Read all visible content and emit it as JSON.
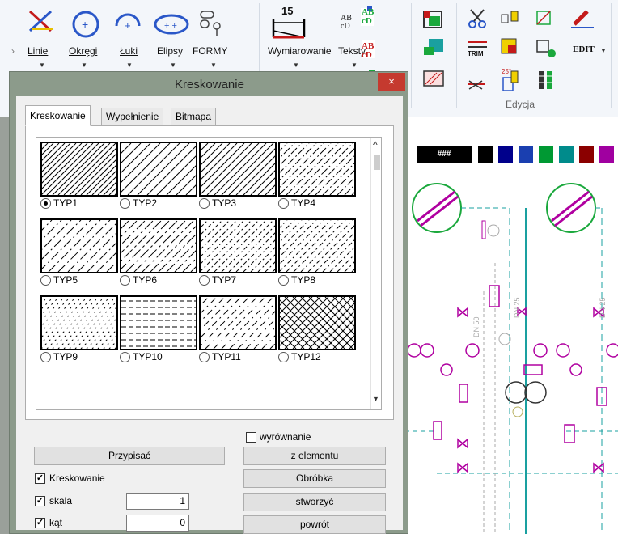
{
  "ribbon": {
    "groups": [
      {
        "label": "Linie",
        "icon": "line-tool-icon"
      },
      {
        "label": "Okręgi",
        "icon": "circle-tool-icon"
      },
      {
        "label": "Łuki",
        "icon": "arc-tool-icon"
      },
      {
        "label": "Elipsy",
        "icon": "ellipse-tool-icon"
      },
      {
        "label": "FORMY",
        "icon": "forms-tool-icon"
      },
      {
        "label": "Wymiarowanie",
        "icon": "dimension-tool-icon"
      },
      {
        "label": "Teksty",
        "icon": "text-tool-icon"
      }
    ],
    "dimension_value": "15",
    "text_icon_glyph": "AB\ncD",
    "trim_label": "TRIM",
    "edit_label": "EDIT",
    "edit_group_label": "Edycja",
    "angle_icon_text": "25°"
  },
  "palette": {
    "hash_label": "###",
    "colors": [
      "#000000",
      "#00008b",
      "#1a3fb0",
      "#009933",
      "#008b8b",
      "#8b0000",
      "#a000a0",
      "#808000"
    ]
  },
  "dialog": {
    "title": "Kreskowanie",
    "close_glyph": "×",
    "tabs": [
      "Kreskowanie",
      "Wypełnienie",
      "Bitmapa"
    ],
    "active_tab": 0,
    "selected_pattern": "TYP1",
    "patterns": [
      "TYP1",
      "TYP2",
      "TYP3",
      "TYP4",
      "TYP5",
      "TYP6",
      "TYP7",
      "TYP8",
      "TYP9",
      "TYP10",
      "TYP11",
      "TYP12"
    ],
    "align_label": "wyrównanie",
    "align_checked": false,
    "assign_label": "Przypisać",
    "from_element_label": "z elementu",
    "processing_label": "Obróbka",
    "create_label": "stworzyć",
    "back_label": "powrót",
    "hatching_label": "Kreskowanie",
    "hatching_checked": true,
    "scale_label": "skala",
    "scale_checked": true,
    "scale_value": "1",
    "angle_label": "kąt",
    "angle_checked": true,
    "angle_value": "0",
    "check_glyph": "✓"
  },
  "colors": {
    "drawing_green": "#1aa83c",
    "drawing_magenta": "#b000a0",
    "drawing_teal": "#1aa0a0",
    "close_red": "#c53a2f"
  }
}
